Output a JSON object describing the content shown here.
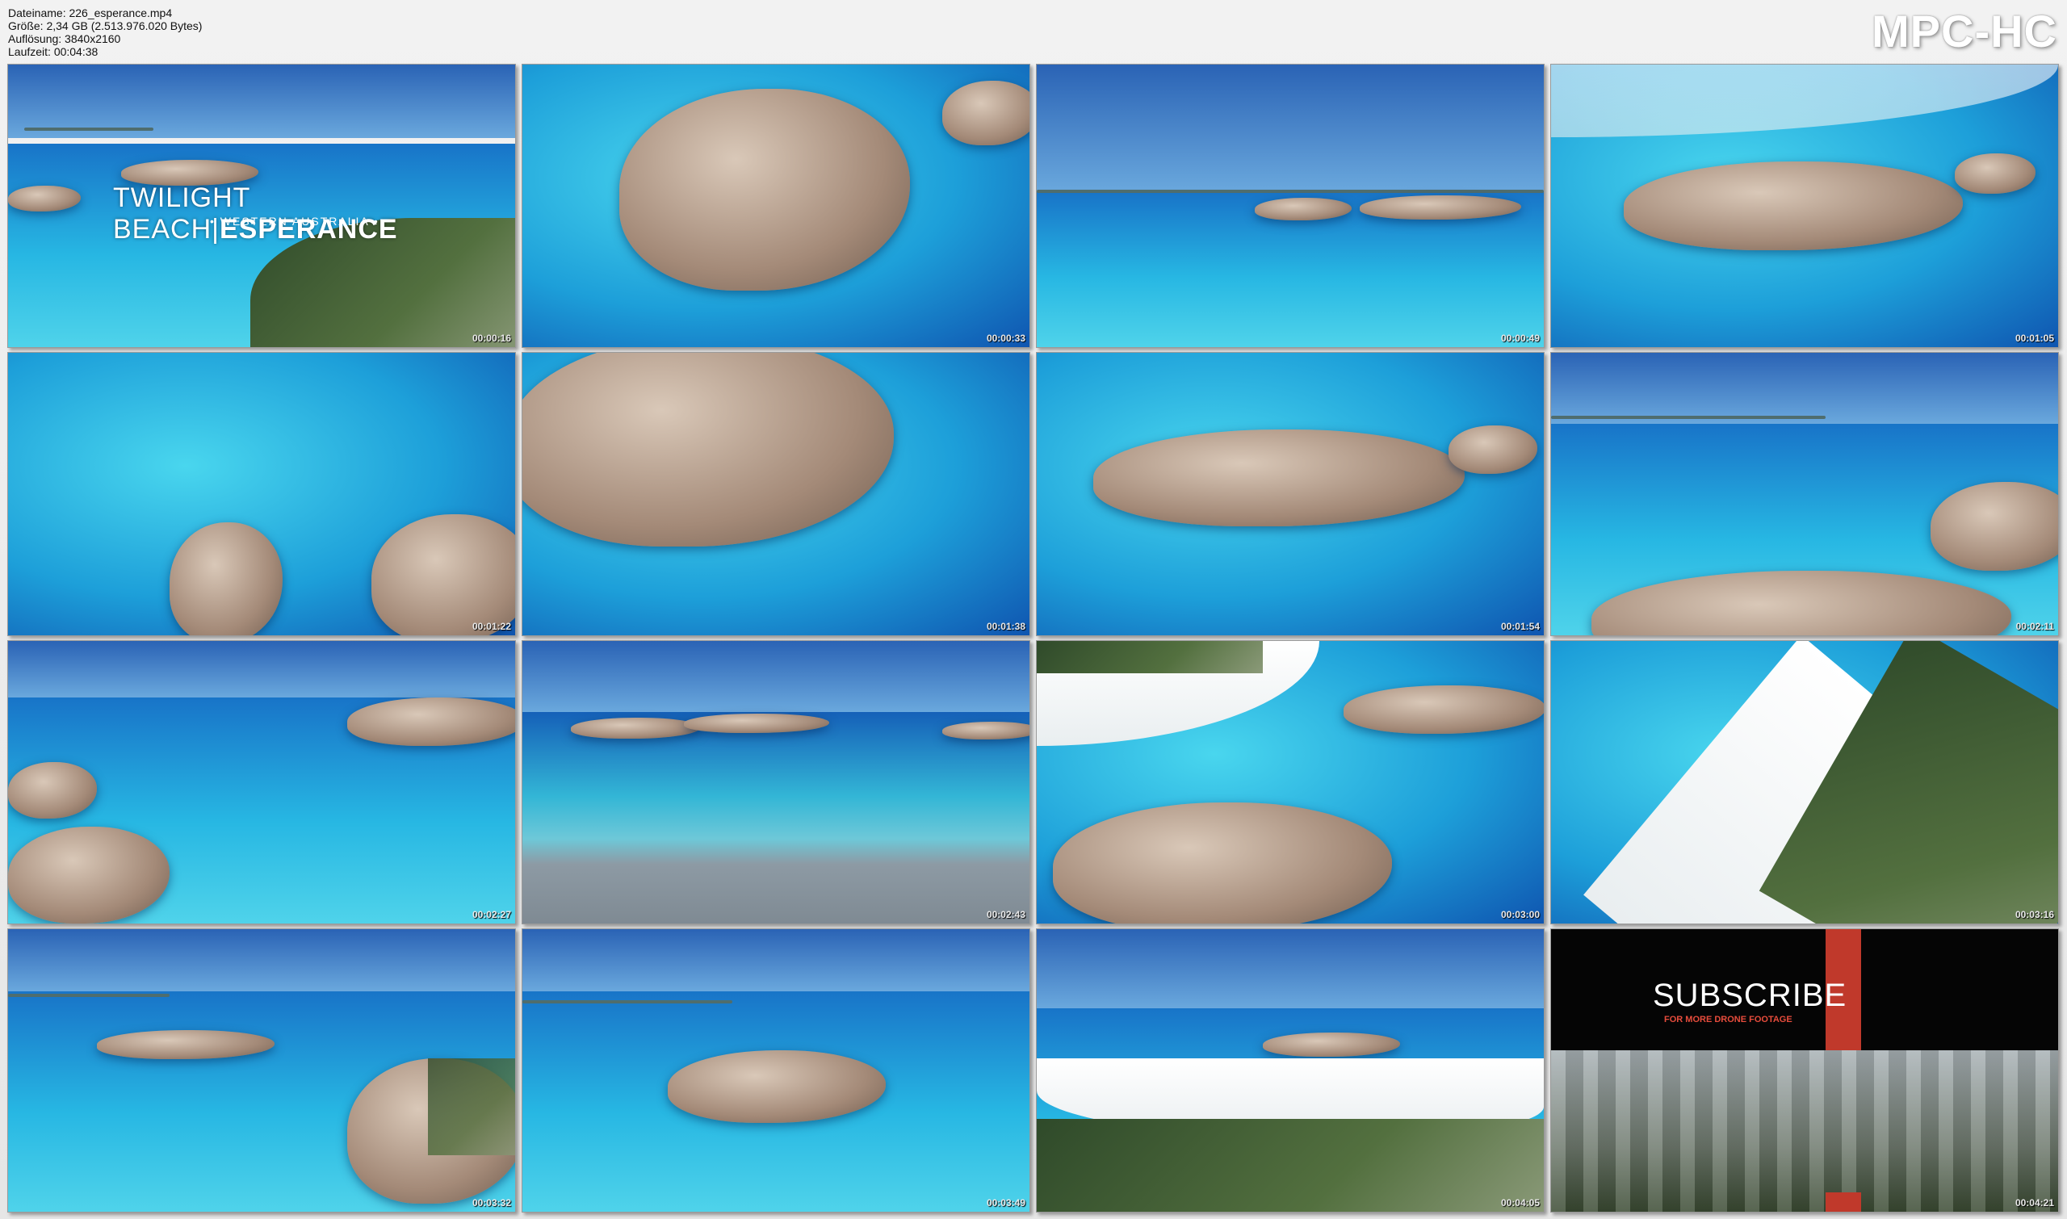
{
  "file_info": {
    "filename": "Dateiname: 226_esperance.mp4",
    "size": "Größe: 2,34 GB (2.513.976.020 Bytes)",
    "resolution": "Auflösung: 3840x2160",
    "duration": "Laufzeit: 00:04:38"
  },
  "brand": "MPC-HC",
  "title_overlay": {
    "left": "TWILIGHT BEACH",
    "right": "ESPERANCE",
    "subtitle": "• WESTERN AUSTRALIA •"
  },
  "subscribe": {
    "label": "SUBSCRIBE",
    "sub": "FOR MORE DRONE FOOTAGE"
  },
  "thumbnails": [
    {
      "timestamp": "00:00:16"
    },
    {
      "timestamp": "00:00:33"
    },
    {
      "timestamp": "00:00:49"
    },
    {
      "timestamp": "00:01:05"
    },
    {
      "timestamp": "00:01:22"
    },
    {
      "timestamp": "00:01:38"
    },
    {
      "timestamp": "00:01:54"
    },
    {
      "timestamp": "00:02:11"
    },
    {
      "timestamp": "00:02:27"
    },
    {
      "timestamp": "00:02:43"
    },
    {
      "timestamp": "00:03:00"
    },
    {
      "timestamp": "00:03:16"
    },
    {
      "timestamp": "00:03:32"
    },
    {
      "timestamp": "00:03:49"
    },
    {
      "timestamp": "00:04:05"
    },
    {
      "timestamp": "00:04:21"
    }
  ]
}
